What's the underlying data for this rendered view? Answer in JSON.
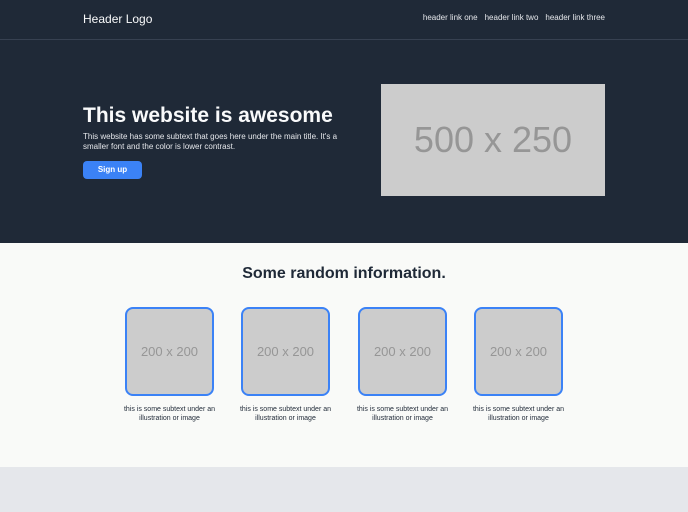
{
  "header": {
    "logo": "Header Logo",
    "links": [
      "header link one",
      "header link two",
      "header link three"
    ]
  },
  "hero": {
    "title": "This website is awesome",
    "subtext": "This website has some subtext that goes here under the main title. It's a smaller font and the color is lower contrast.",
    "button": "Sign up",
    "image_label": "500 x 250"
  },
  "info": {
    "title": "Some random information.",
    "cards": [
      {
        "image_label": "200 x 200",
        "text": "this is some subtext under an illustration or image"
      },
      {
        "image_label": "200 x 200",
        "text": "this is some subtext under an illustration or image"
      },
      {
        "image_label": "200 x 200",
        "text": "this is some subtext under an illustration or image"
      },
      {
        "image_label": "200 x 200",
        "text": "this is some subtext under an illustration or image"
      }
    ]
  },
  "colors": {
    "dark_bg": "#1f2937",
    "accent": "#3b82f6",
    "light_bg": "#f9faf8",
    "placeholder": "#cccccc"
  }
}
